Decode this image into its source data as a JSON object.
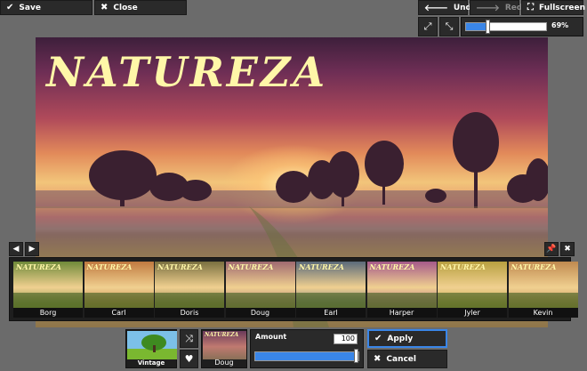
{
  "toolbar": {
    "save_label": "Save",
    "close_label": "Close",
    "undo_label": "Undo",
    "redo_label": "Redo",
    "fullscreen_label": "Fullscreen",
    "zoom_percent_label": "69%",
    "zoom_fraction": 0.27
  },
  "canvas": {
    "overlay_text": "NATUREZA"
  },
  "filters": {
    "thumbnail_text": "NATUREZA",
    "items": [
      {
        "label": "Borg",
        "tint": "#6f8a3a"
      },
      {
        "label": "Carl",
        "tint": "#c07a40"
      },
      {
        "label": "Doris",
        "tint": "#7a7040"
      },
      {
        "label": "Doug",
        "tint": "#a06a70"
      },
      {
        "label": "Earl",
        "tint": "#5a6a7a"
      },
      {
        "label": "Harper",
        "tint": "#a65a8a"
      },
      {
        "label": "Jyler",
        "tint": "#b8a040"
      },
      {
        "label": "Kevin",
        "tint": "#c08a50"
      }
    ]
  },
  "bottom": {
    "category_label": "Vintage",
    "selected_filter_label": "Doug",
    "selected_filter_text": "NATUREZA",
    "amount_label": "Amount",
    "amount_value": "100",
    "amount_fraction": 1.0,
    "apply_label": "Apply",
    "cancel_label": "Cancel"
  },
  "colors": {
    "accent": "#3a86e8",
    "toolbar_bg": "#2a2a2a",
    "page_bg": "#6b6b6b"
  }
}
